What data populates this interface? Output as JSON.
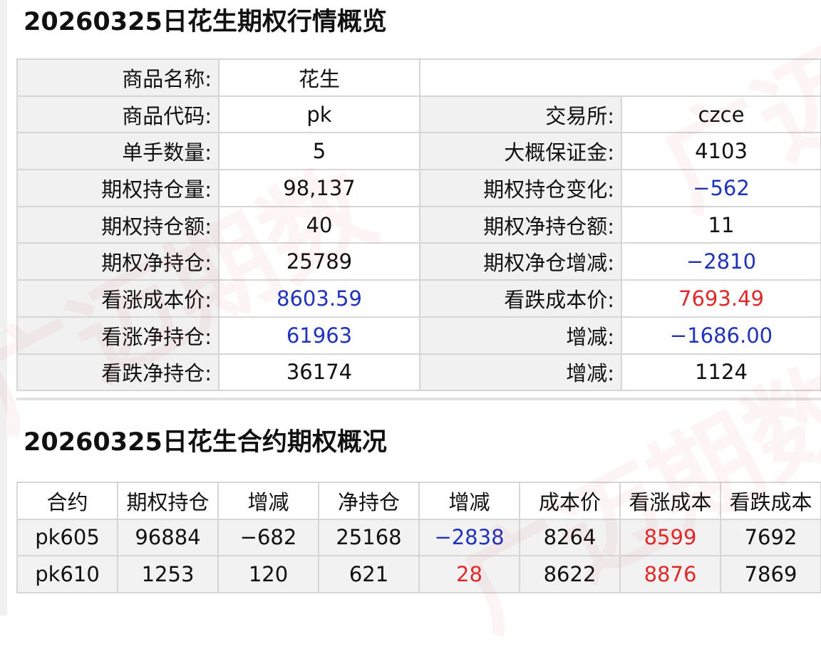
{
  "colors": {
    "blue": "#2233bb",
    "red": "#e02a2a",
    "label_bg": "#f1f1f1"
  },
  "watermark": "广迈期数",
  "overview": {
    "title": "20260325日花生期权行情概览",
    "rows": [
      {
        "l1": "商品名称:",
        "v1": "花生",
        "l2": "",
        "v2": ""
      },
      {
        "l1": "商品代码:",
        "v1": "pk",
        "l2": "交易所:",
        "v2": "czce"
      },
      {
        "l1": "单手数量:",
        "v1": "5",
        "l2": "大概保证金:",
        "v2": "4103"
      },
      {
        "l1": "期权持仓量:",
        "v1": "98,137",
        "l2": "期权持仓变化:",
        "v2": "−562",
        "v2_color": "blue"
      },
      {
        "l1": "期权持仓额:",
        "v1": "40",
        "l2": "期权净持仓额:",
        "v2": "11"
      },
      {
        "l1": "期权净持仓:",
        "v1": "25789",
        "l2": "期权净仓增减:",
        "v2": "−2810",
        "v2_color": "blue"
      },
      {
        "l1": "看涨成本价:",
        "v1": "8603.59",
        "v1_color": "blue",
        "l2": "看跌成本价:",
        "v2": "7693.49",
        "v2_color": "red"
      },
      {
        "l1": "看涨净持仓:",
        "v1": "61963",
        "v1_color": "blue",
        "l2": "增减:",
        "v2": "−1686.00",
        "v2_color": "blue"
      },
      {
        "l1": "看跌净持仓:",
        "v1": "36174",
        "l2": "增减:",
        "v2": "1124"
      }
    ]
  },
  "contracts": {
    "title": "20260325日花生合约期权概况",
    "headers": [
      "合约",
      "期权持仓",
      "增减",
      "净持仓",
      "增减",
      "成本价",
      "看涨成本",
      "看跌成本"
    ],
    "rows": [
      [
        "pk605",
        "96884",
        "−682",
        "25168",
        "−2838",
        "8264",
        "8599",
        "7692"
      ],
      [
        "pk610",
        "1253",
        "120",
        "621",
        "28",
        "8622",
        "8876",
        "7869"
      ]
    ],
    "cell_colors": [
      [
        "",
        "",
        "",
        "",
        "blue",
        "",
        "red",
        ""
      ],
      [
        "",
        "",
        "",
        "",
        "red",
        "",
        "red",
        ""
      ]
    ]
  }
}
